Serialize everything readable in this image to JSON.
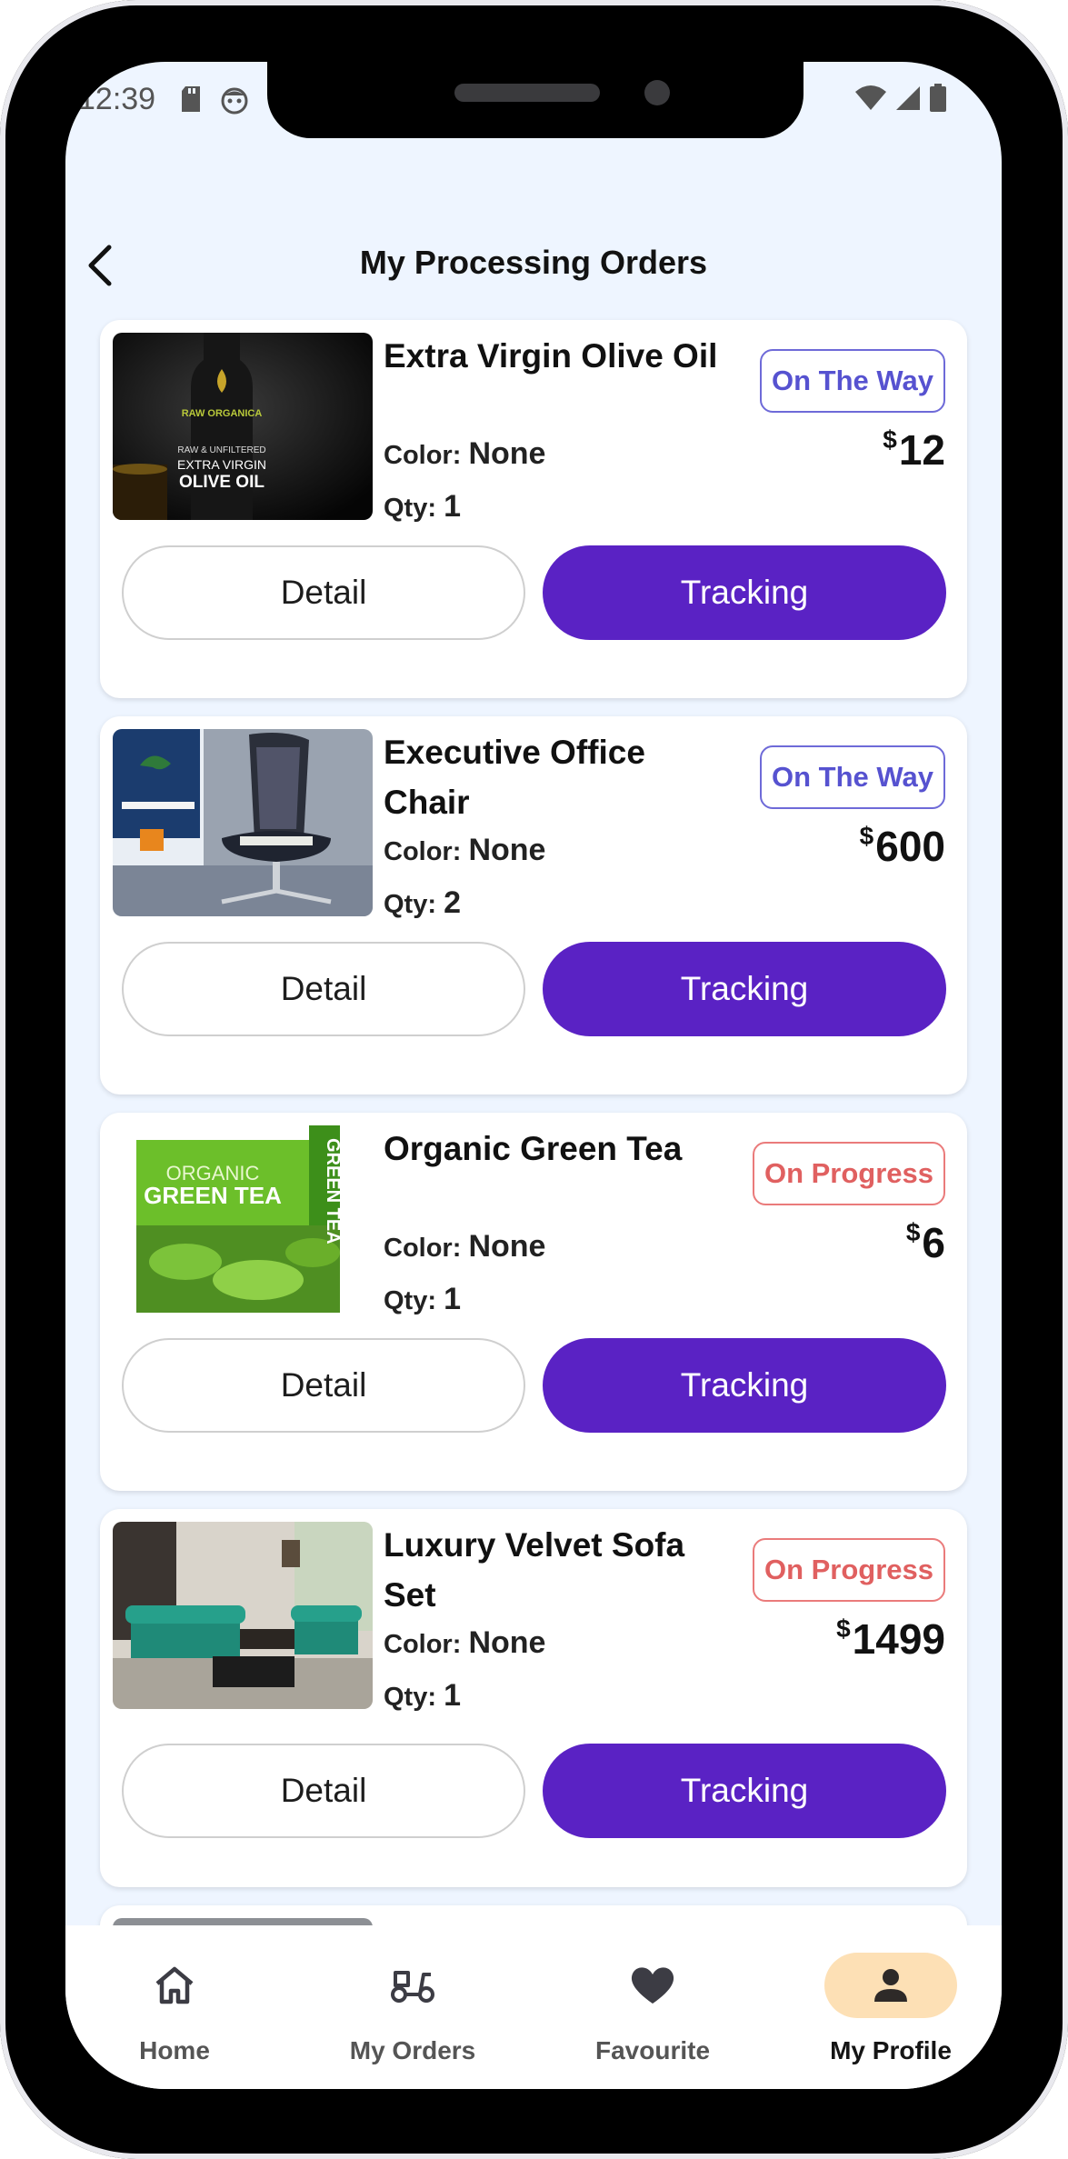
{
  "status": {
    "time": "12:39"
  },
  "header": {
    "title": "My Processing Orders"
  },
  "labels": {
    "color": "Color:",
    "qty": "Qty:",
    "currency": "$",
    "detail": "Detail",
    "tracking": "Tracking"
  },
  "orders": [
    {
      "name": "Extra Virgin Olive Oil",
      "status": "On The Way",
      "color": "None",
      "qty": "1",
      "price": "12",
      "image_text": {
        "brand": "RAW ORGANICA",
        "sub": "RAW & UNFILTERED",
        "l1": "EXTRA VIRGIN",
        "l2": "OLIVE OIL"
      }
    },
    {
      "name": "Executive Office Chair",
      "status": "On The Way",
      "color": "None",
      "qty": "2",
      "price": "600"
    },
    {
      "name": "Organic Green Tea",
      "status": "On Progress",
      "color": "None",
      "qty": "1",
      "price": "6",
      "image_text": {
        "l1": "ORGANIC",
        "l2": "GREEN TEA",
        "side": "GREEN TEA"
      }
    },
    {
      "name": "Luxury Velvet Sofa Set",
      "status": "On Progress",
      "color": "None",
      "qty": "1",
      "price": "1499"
    }
  ],
  "nav": [
    {
      "label": "Home",
      "icon": "home-icon"
    },
    {
      "label": "My Orders",
      "icon": "scooter-icon"
    },
    {
      "label": "Favourite",
      "icon": "heart-icon"
    },
    {
      "label": "My Profile",
      "icon": "person-icon",
      "active": true
    }
  ],
  "colors": {
    "primary": "#5a22c4",
    "on_the_way": "#5652d0",
    "on_progress": "#e06060",
    "active_nav_bg": "#fde0b5",
    "background": "#eef5ff"
  }
}
